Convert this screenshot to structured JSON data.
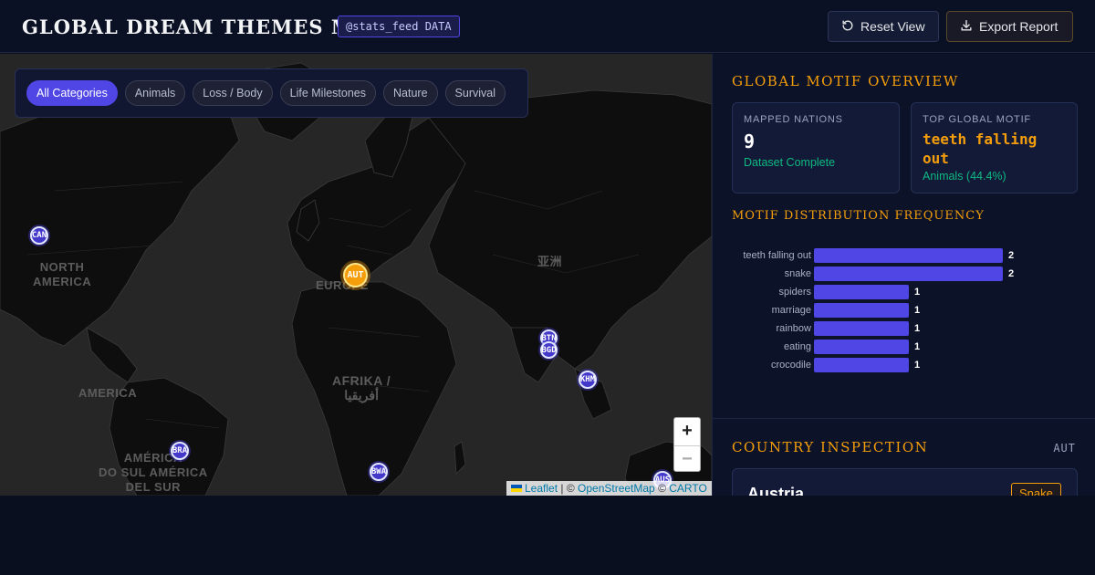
{
  "header": {
    "title": "GLOBAL DREAM THEMES MAP",
    "source_badge": "@stats_feed DATA",
    "reset_label": "Reset View",
    "export_label": "Export Report"
  },
  "filters": {
    "items": [
      "All Categories",
      "Animals",
      "Loss / Body",
      "Life Milestones",
      "Nature",
      "Survival"
    ],
    "active": "All Categories"
  },
  "map": {
    "region_labels": {
      "north_america": "NORTH\nAMERICA",
      "europe": "EUROPE",
      "asia": "亚洲",
      "africa": "AFRIKA /\nأفريقيا",
      "america": "AMERICA",
      "south_america": "AMÉRICA\nDO SUL AMÉRICA\nDEL SUR"
    },
    "markers": [
      {
        "code": "CAN",
        "selected": false
      },
      {
        "code": "AUT",
        "selected": true
      },
      {
        "code": "BTN",
        "selected": false
      },
      {
        "code": "BGD",
        "selected": false
      },
      {
        "code": "KHM",
        "selected": false
      },
      {
        "code": "BRA",
        "selected": false
      },
      {
        "code": "BWA",
        "selected": false
      },
      {
        "code": "AUS",
        "selected": false
      }
    ],
    "zoom_in": "+",
    "zoom_out": "−",
    "attribution": {
      "leaflet": "Leaflet",
      "sep1": "| ©",
      "osm": "OpenStreetMap",
      "sep2": "©",
      "carto": "CARTO"
    }
  },
  "overview": {
    "title": "GLOBAL MOTIF OVERVIEW",
    "mapped": {
      "label": "MAPPED NATIONS",
      "value": "9",
      "sub": "Dataset Complete"
    },
    "top_motif": {
      "label": "TOP GLOBAL MOTIF",
      "value": "teeth falling out",
      "sub": "Animals (44.4%)"
    }
  },
  "distribution": {
    "title": "MOTIF DISTRIBUTION FREQUENCY"
  },
  "chart_data": {
    "type": "bar",
    "orientation": "horizontal",
    "title": "MOTIF DISTRIBUTION FREQUENCY",
    "categories": [
      "teeth falling out",
      "snake",
      "spiders",
      "marriage",
      "rainbow",
      "eating",
      "crocodile"
    ],
    "values": [
      2,
      2,
      1,
      1,
      1,
      1,
      1
    ],
    "color": "#4f46e5"
  },
  "inspection": {
    "title": "COUNTRY INSPECTION",
    "code": "AUT",
    "country": "Austria",
    "motif_badge": "Snake"
  },
  "colors": {
    "accent": "#f59e0b",
    "primary": "#4f46e5",
    "success": "#10b981"
  }
}
